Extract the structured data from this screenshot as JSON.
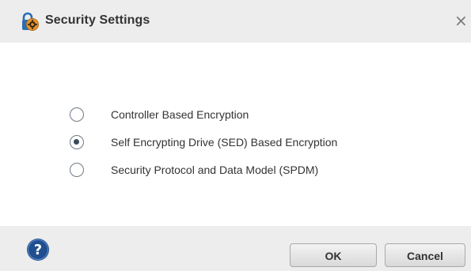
{
  "dialog": {
    "title": "Security Settings",
    "title_icon": "lock-gear-icon",
    "close_label": "×",
    "close_icon": "close-icon"
  },
  "options": [
    {
      "label": "Controller Based Encryption",
      "selected": false
    },
    {
      "label": "Self Encrypting Drive (SED) Based Encryption",
      "selected": true
    },
    {
      "label": "Security Protocol and Data Model (SPDM)",
      "selected": false
    }
  ],
  "footer": {
    "help_icon": "help-icon",
    "ok_label": "OK",
    "cancel_label": "Cancel"
  },
  "colors": {
    "titlebar_bg": "#ededed",
    "help_blue": "#1f4f8f",
    "lock_orange": "#e8952f"
  }
}
